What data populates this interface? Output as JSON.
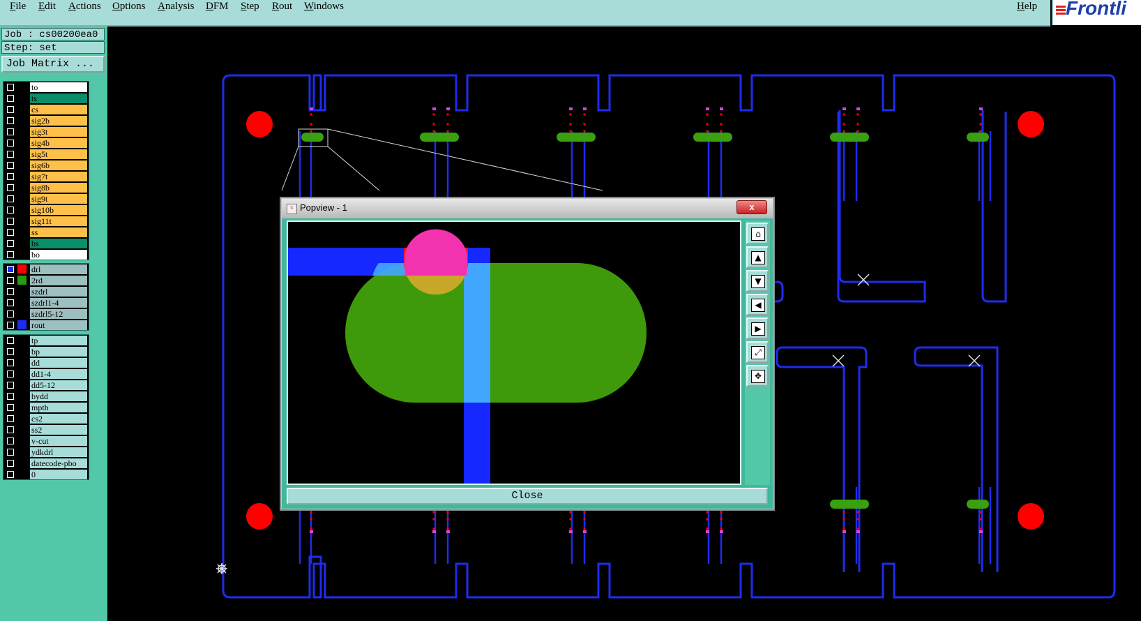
{
  "menu": {
    "items": [
      "File",
      "Edit",
      "Actions",
      "Options",
      "Analysis",
      "DFM",
      "Step",
      "Rout",
      "Windows"
    ],
    "help": "Help"
  },
  "logo": "Frontli",
  "job": {
    "job_label": "Job : cs00200ea0",
    "step_label": "Step: set",
    "matrix_button": "Job Matrix ..."
  },
  "colors": {
    "accent_panel": "#52c8a8",
    "menu_bg": "#a8dcd8",
    "board_outline": "#1e2cf0",
    "pad_green": "#3aa010",
    "drill_red": "#ff0000",
    "teal_layer": "#0a8f6a",
    "orange_layer": "#ffc04a"
  },
  "layers": {
    "board": [
      {
        "name": "to",
        "color": "#ffffff"
      },
      {
        "name": "ts",
        "color": "#0a8f6a"
      },
      {
        "name": "cs",
        "color": "#ffc04a"
      },
      {
        "name": "sig2b",
        "color": "#ffc04a"
      },
      {
        "name": "sig3t",
        "color": "#ffc04a"
      },
      {
        "name": "sig4b",
        "color": "#ffc04a"
      },
      {
        "name": "sig5t",
        "color": "#ffc04a"
      },
      {
        "name": "sig6b",
        "color": "#ffc04a"
      },
      {
        "name": "sig7t",
        "color": "#ffc04a"
      },
      {
        "name": "sig8b",
        "color": "#ffc04a"
      },
      {
        "name": "sig9t",
        "color": "#ffc04a"
      },
      {
        "name": "sig10b",
        "color": "#ffc04a"
      },
      {
        "name": "sig11t",
        "color": "#ffc04a"
      },
      {
        "name": "ss",
        "color": "#ffc04a"
      },
      {
        "name": "bs",
        "color": "#0a8f6a"
      },
      {
        "name": "bo",
        "color": "#ffffff"
      }
    ],
    "drill": [
      {
        "name": "drl",
        "color": "#9dbfc0",
        "swatch": "#ff0000",
        "active": true
      },
      {
        "name": "2rd",
        "color": "#9dbfc0",
        "swatch": "#2a9a10"
      },
      {
        "name": "szdrl",
        "color": "#9dbfc0"
      },
      {
        "name": "szdrl1-4",
        "color": "#9dbfc0"
      },
      {
        "name": "szdrl5-12",
        "color": "#9dbfc0"
      },
      {
        "name": "rout",
        "color": "#9dbfc0",
        "swatch": "#1e2cf0"
      }
    ],
    "misc": [
      {
        "name": "tp",
        "color": "#a8dcd8"
      },
      {
        "name": "bp",
        "color": "#a8dcd8"
      },
      {
        "name": "dd",
        "color": "#a8dcd8"
      },
      {
        "name": "dd1-4",
        "color": "#a8dcd8"
      },
      {
        "name": "dd5-12",
        "color": "#a8dcd8"
      },
      {
        "name": "bydd",
        "color": "#a8dcd8"
      },
      {
        "name": "mpth",
        "color": "#a8dcd8"
      },
      {
        "name": "cs2",
        "color": "#a8dcd8"
      },
      {
        "name": "ss2",
        "color": "#a8dcd8"
      },
      {
        "name": "v-cut",
        "color": "#a8dcd8"
      },
      {
        "name": "ydkdrl",
        "color": "#a8dcd8"
      },
      {
        "name": "datecode-pbo",
        "color": "#a8dcd8"
      },
      {
        "name": "0",
        "color": "#a8dcd8"
      }
    ]
  },
  "popview": {
    "title": "Popview - 1",
    "close_x": "x",
    "close_button": "Close",
    "tools": [
      "zoom-home-icon",
      "pan-up-icon",
      "pan-down-icon",
      "pan-left-icon",
      "pan-right-icon",
      "zoom-fit-icon",
      "zoom-page-icon"
    ]
  }
}
